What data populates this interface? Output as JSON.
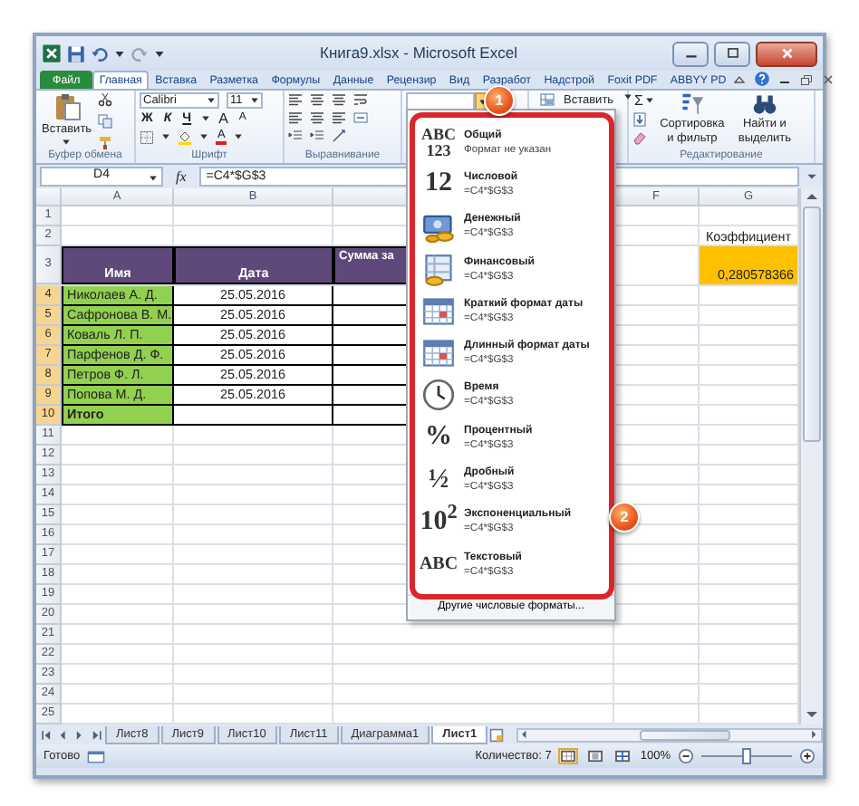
{
  "window": {
    "title": "Книга9.xlsx - Microsoft Excel"
  },
  "ribbon_tabs": [
    {
      "label": "Файл",
      "kind": "file",
      "selected": false
    },
    {
      "label": "Главная",
      "kind": "tab",
      "selected": true
    },
    {
      "label": "Вставка",
      "kind": "tab",
      "selected": false
    },
    {
      "label": "Разметка",
      "kind": "tab",
      "selected": false
    },
    {
      "label": "Формулы",
      "kind": "tab",
      "selected": false
    },
    {
      "label": "Данные",
      "kind": "tab",
      "selected": false
    },
    {
      "label": "Рецензир",
      "kind": "tab",
      "selected": false
    },
    {
      "label": "Вид",
      "kind": "tab",
      "selected": false
    },
    {
      "label": "Разработ",
      "kind": "tab",
      "selected": false
    },
    {
      "label": "Надстрой",
      "kind": "tab",
      "selected": false
    },
    {
      "label": "Foxit PDF",
      "kind": "tab",
      "selected": false
    },
    {
      "label": "ABBYY PD",
      "kind": "tab",
      "selected": false
    }
  ],
  "ribbon": {
    "clipboard": {
      "paste": "Вставить",
      "label": "Буфер обмена"
    },
    "font": {
      "name": "Calibri",
      "size": "11",
      "styles": [
        "Ж",
        "К",
        "Ч"
      ],
      "grow": "A",
      "shrink": "A",
      "color_button": "A",
      "label": "Шрифт"
    },
    "alignment": {
      "label": "Выравнивание"
    },
    "number": {
      "open": true
    },
    "cells": {
      "insert": "Вставить"
    },
    "editing": {
      "sum": "Σ",
      "sort": "Сортировка и фильтр",
      "find": "Найти и выделить",
      "label": "Редактирование"
    }
  },
  "formula_bar": {
    "name_box": "D4",
    "function_label": "fx",
    "formula": "=C4*$G$3"
  },
  "columns": {
    "a": "A",
    "b": "B",
    "f": "F",
    "g": "G"
  },
  "rows": [
    {
      "number": "1",
      "selected": false
    },
    {
      "number": "2",
      "selected": false,
      "cells": {
        "g": {
          "text": "Коэффициент",
          "kind": "plain"
        }
      }
    },
    {
      "number": "3",
      "selected": false,
      "cells": {
        "a": {
          "text": "Имя",
          "kind": "header"
        },
        "b": {
          "text": "Дата",
          "kind": "header"
        },
        "c": {
          "text": "Сумма за",
          "kind": "header"
        },
        "g": {
          "text": "0,280578366",
          "kind": "highlight"
        }
      }
    },
    {
      "number": "4",
      "selected": true,
      "cells": {
        "a": {
          "text": "Николаев А. Д.",
          "kind": "name"
        },
        "b": {
          "text": "25.05.2016",
          "kind": "data"
        },
        "c": {
          "kind": "data"
        }
      }
    },
    {
      "number": "5",
      "selected": true,
      "cells": {
        "a": {
          "text": "Сафронова В. М.",
          "kind": "name"
        },
        "b": {
          "text": "25.05.2016",
          "kind": "data"
        },
        "c": {
          "kind": "data"
        }
      }
    },
    {
      "number": "6",
      "selected": true,
      "cells": {
        "a": {
          "text": "Коваль Л. П.",
          "kind": "name"
        },
        "b": {
          "text": "25.05.2016",
          "kind": "data"
        },
        "c": {
          "kind": "data"
        }
      }
    },
    {
      "number": "7",
      "selected": true,
      "cells": {
        "a": {
          "text": "Парфенов Д. Ф.",
          "kind": "name"
        },
        "b": {
          "text": "25.05.2016",
          "kind": "data"
        },
        "c": {
          "kind": "data"
        }
      }
    },
    {
      "number": "8",
      "selected": true,
      "cells": {
        "a": {
          "text": "Петров Ф. Л.",
          "kind": "name"
        },
        "b": {
          "text": "25.05.2016",
          "kind": "data"
        },
        "c": {
          "kind": "data"
        }
      }
    },
    {
      "number": "9",
      "selected": true,
      "cells": {
        "a": {
          "text": "Попова М. Д.",
          "kind": "name"
        },
        "b": {
          "text": "25.05.2016",
          "kind": "data"
        },
        "c": {
          "kind": "data"
        }
      }
    },
    {
      "number": "10",
      "selected": true,
      "cells": {
        "a": {
          "text": "Итого",
          "kind": "total"
        },
        "b": {
          "kind": "data"
        },
        "c": {
          "kind": "data"
        }
      }
    },
    {
      "number": "11",
      "selected": false
    },
    {
      "number": "12",
      "selected": false
    },
    {
      "number": "13",
      "selected": false
    },
    {
      "number": "14",
      "selected": false
    },
    {
      "number": "15",
      "selected": false
    },
    {
      "number": "16",
      "selected": false
    },
    {
      "number": "17",
      "selected": false
    },
    {
      "number": "18",
      "selected": false
    },
    {
      "number": "19",
      "selected": false
    },
    {
      "number": "20",
      "selected": false
    },
    {
      "number": "21",
      "selected": false
    },
    {
      "number": "22",
      "selected": false
    },
    {
      "number": "23",
      "selected": false
    },
    {
      "number": "24",
      "selected": false
    },
    {
      "number": "25",
      "selected": false
    }
  ],
  "number_format_menu": {
    "items": [
      {
        "kind": "glyph",
        "glyph": [
          "ABC",
          "123"
        ],
        "title": "Общий",
        "subtitle": "Формат не указан"
      },
      {
        "kind": "glyph",
        "glyph": [
          "12"
        ],
        "title": "Числовой",
        "subtitle": "=C4*$G$3"
      },
      {
        "kind": "money",
        "title": "Денежный",
        "subtitle": "=C4*$G$3"
      },
      {
        "kind": "ledger",
        "title": "Финансовый",
        "subtitle": "=C4*$G$3"
      },
      {
        "kind": "calendar",
        "title": "Краткий формат даты",
        "subtitle": "=C4*$G$3"
      },
      {
        "kind": "calendar",
        "title": "Длинный формат даты",
        "subtitle": "=C4*$G$3"
      },
      {
        "kind": "clock",
        "title": "Время",
        "subtitle": "=C4*$G$3"
      },
      {
        "kind": "glyph",
        "glyph": [
          "%"
        ],
        "title": "Процентный",
        "subtitle": "=C4*$G$3"
      },
      {
        "kind": "glyph",
        "glyph": [
          "½"
        ],
        "title": "Дробный",
        "subtitle": "=C4*$G$3"
      },
      {
        "kind": "glyph",
        "glyph": [
          "10$^{2}$"
        ],
        "title": "Экспоненциальный",
        "subtitle": "=C4*$G$3"
      },
      {
        "kind": "glyph",
        "glyph": [
          "ABC"
        ],
        "title": "Текстовый",
        "subtitle": "=C4*$G$3"
      }
    ],
    "footer": "Другие числовые форматы..."
  },
  "callouts": [
    {
      "label": "1"
    },
    {
      "label": "2"
    }
  ],
  "sheet_tabs": [
    {
      "label": "Лист8",
      "selected": false
    },
    {
      "label": "Лист9",
      "selected": false
    },
    {
      "label": "Лист10",
      "selected": false
    },
    {
      "label": "Лист11",
      "selected": false
    },
    {
      "label": "Диаграмма1",
      "selected": false
    },
    {
      "label": "Лист1",
      "selected": true
    }
  ],
  "status_bar": {
    "state": "Готово",
    "count": "Количество: 7",
    "views": [
      {
        "selected": true
      },
      {
        "selected": false
      },
      {
        "selected": false
      }
    ],
    "zoom": "100%",
    "zoom_slider": {
      "level": 0.5
    }
  }
}
